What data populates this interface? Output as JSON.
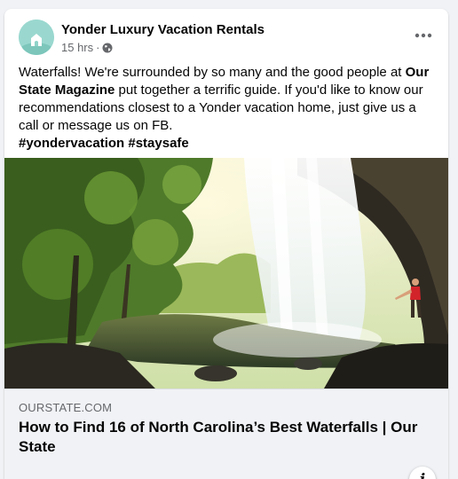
{
  "post": {
    "page_name": "Yonder Luxury Vacation Rentals",
    "time": "15 hrs",
    "separator": "·",
    "privacy_icon": "globe-icon",
    "more_icon": "more-options-icon",
    "text_intro": "Waterfalls! We're surrounded by so many and the good people at ",
    "text_bold": "Our State Magazine",
    "text_rest": " put together a terrific guide. If you'd like to know our recommendations closest to a Yonder vacation home, just give us a call or message us on FB.",
    "hashtags": "#yondervacation #staysafe"
  },
  "link": {
    "domain": "OURSTATE.COM",
    "title": "How to Find 16 of North Carolina’s Best Waterfalls | Our State",
    "info_icon": "i"
  },
  "colors": {
    "background": "#f0f2f5",
    "card": "#ffffff",
    "secondary_text": "#65676b",
    "avatar": "#8fd3c9"
  }
}
